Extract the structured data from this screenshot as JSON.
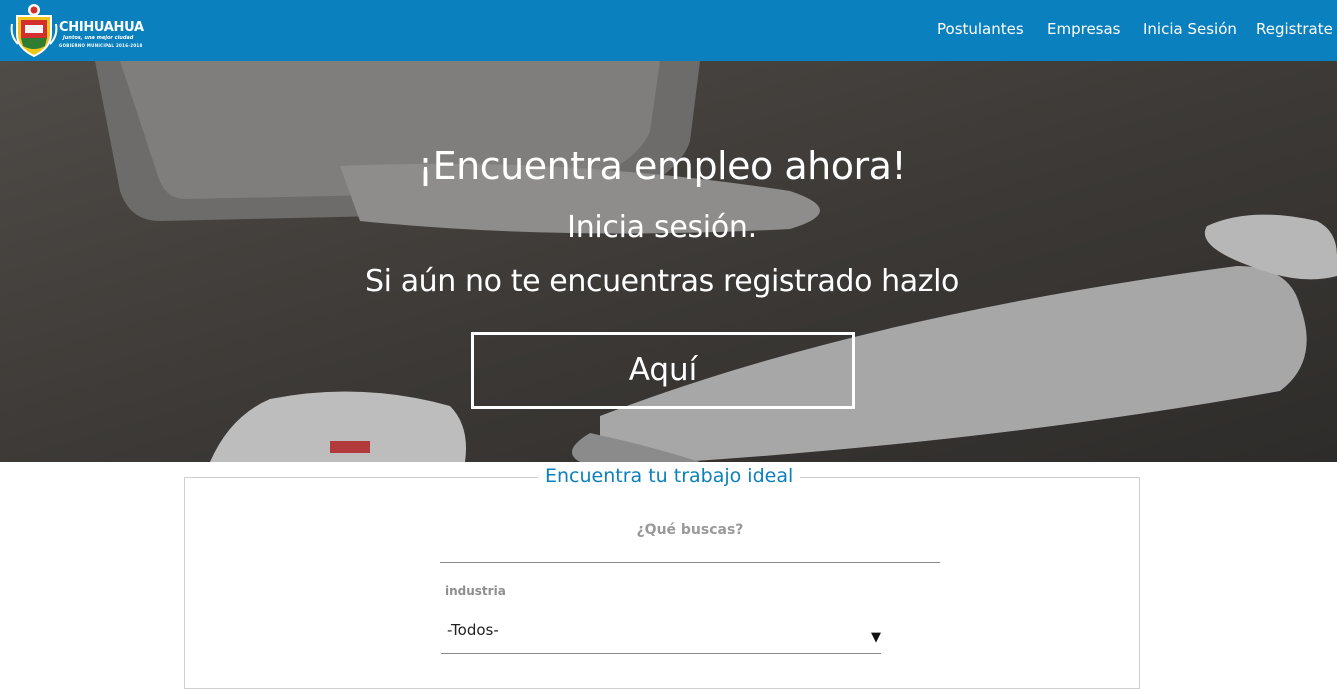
{
  "brand": {
    "name": "CHIHUAHUA",
    "slogan": "Juntos, una mejor ciudad",
    "government": "GOBIERNO MUNICIPAL 2016-2018",
    "colors": {
      "primary": "#0b80be",
      "white": "#ffffff"
    }
  },
  "nav": {
    "items": [
      "Postulantes",
      "Empresas",
      "Inicia Sesión",
      "Registrate"
    ]
  },
  "hero": {
    "title": "¡Encuentra empleo ahora!",
    "line1": "Inicia sesión.",
    "line2": "Si aún no te encuentras registrado hazlo",
    "cta": "Aquí"
  },
  "search": {
    "legend": "Encuentra tu trabajo ideal",
    "query_label": "¿Qué buscas?",
    "query_value": "",
    "industry_label": "industria",
    "industry_selected": "-Todos-",
    "dropdown_icon": "triangle-down-icon"
  }
}
